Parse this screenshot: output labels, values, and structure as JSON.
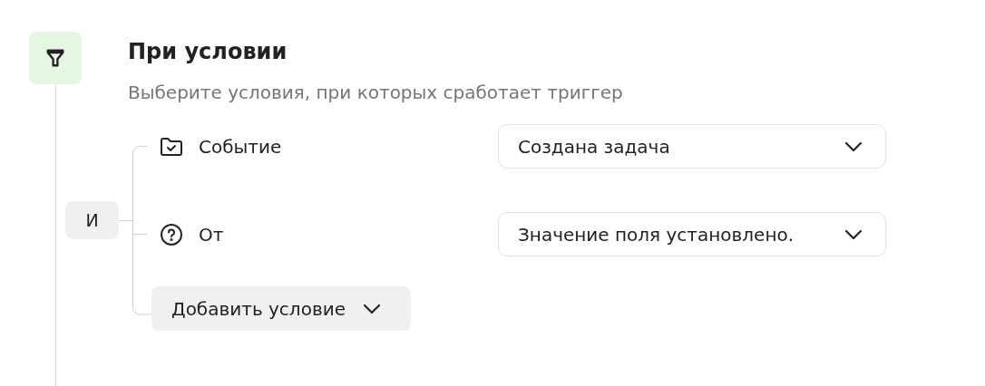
{
  "header": {
    "title": "При условии",
    "subtitle": "Выберите условия, при которых сработает триггер"
  },
  "operator": "И",
  "conditions": [
    {
      "kind": "event",
      "label": "Событие",
      "value": "Создана задача"
    },
    {
      "kind": "question",
      "label": "От",
      "value": "Значение поля установлено."
    }
  ],
  "add_button": "Добавить условие"
}
